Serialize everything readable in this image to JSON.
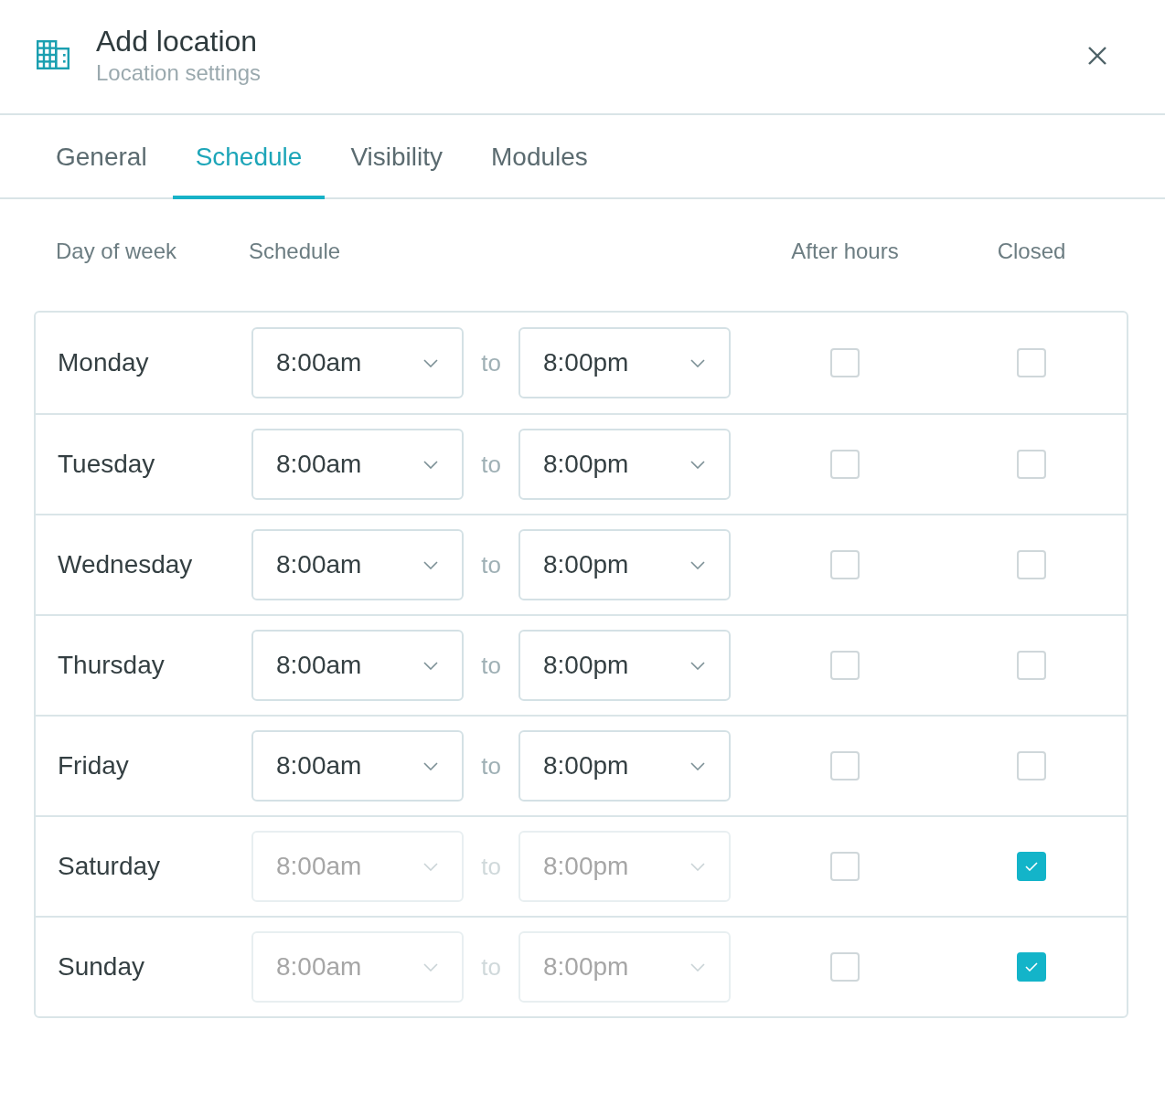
{
  "dialog": {
    "title": "Add location",
    "subtitle": "Location settings"
  },
  "tabs": [
    {
      "label": "General",
      "selected": false
    },
    {
      "label": "Schedule",
      "selected": true
    },
    {
      "label": "Visibility",
      "selected": false
    },
    {
      "label": "Modules",
      "selected": false
    }
  ],
  "columns": [
    "Day of week",
    "Schedule",
    "After hours",
    "Closed"
  ],
  "rows": [
    {
      "day": "Monday",
      "start": {
        "value": "8:00am",
        "disabled": false
      },
      "separator": "to",
      "end": {
        "value": "8:00pm",
        "disabled": false
      },
      "after_hours": false,
      "closed": false
    },
    {
      "day": "Tuesday",
      "start": {
        "value": "8:00am",
        "disabled": false
      },
      "separator": "to",
      "end": {
        "value": "8:00pm",
        "disabled": false
      },
      "after_hours": false,
      "closed": false
    },
    {
      "day": "Wednesday",
      "start": {
        "value": "8:00am",
        "disabled": false
      },
      "separator": "to",
      "end": {
        "value": "8:00pm",
        "disabled": false
      },
      "after_hours": false,
      "closed": false
    },
    {
      "day": "Thursday",
      "start": {
        "value": "8:00am",
        "disabled": false
      },
      "separator": "to",
      "end": {
        "value": "8:00pm",
        "disabled": false
      },
      "after_hours": false,
      "closed": false
    },
    {
      "day": "Friday",
      "start": {
        "value": "8:00am",
        "disabled": false
      },
      "separator": "to",
      "end": {
        "value": "8:00pm",
        "disabled": false
      },
      "after_hours": false,
      "closed": false
    },
    {
      "day": "Saturday",
      "start": {
        "value": "8:00am",
        "disabled": true
      },
      "separator": "to",
      "end": {
        "value": "8:00pm",
        "disabled": true
      },
      "after_hours": false,
      "closed": true
    },
    {
      "day": "Sunday",
      "start": {
        "value": "8:00am",
        "disabled": true
      },
      "separator": "to",
      "end": {
        "value": "8:00pm",
        "disabled": true
      },
      "after_hours": false,
      "closed": true
    }
  ]
}
